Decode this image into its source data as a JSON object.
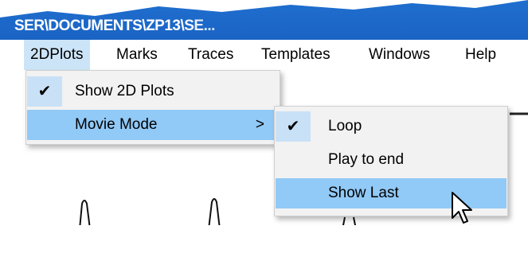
{
  "window": {
    "title": "SER\\DOCUMENTS\\ZP13\\SE..."
  },
  "menubar": {
    "items": [
      {
        "label": "2DPlots"
      },
      {
        "label": "Marks"
      },
      {
        "label": "Traces"
      },
      {
        "label": "Templates"
      },
      {
        "label": "Windows"
      },
      {
        "label": "Help"
      }
    ]
  },
  "dropdown_2dplots": {
    "items": [
      {
        "label": "Show 2D Plots",
        "checked": true,
        "check_glyph": "✔"
      },
      {
        "label": "Movie Mode",
        "submenu_glyph": ">"
      }
    ]
  },
  "submenu_movie_mode": {
    "items": [
      {
        "label": "Loop",
        "checked": true,
        "check_glyph": "✔"
      },
      {
        "label": "Play to end"
      },
      {
        "label": "Show Last"
      }
    ]
  },
  "icons": {
    "checkmark": "checkmark-icon",
    "submenu_arrow": "chevron-right-icon",
    "cursor": "mouse-pointer-icon"
  },
  "colors": {
    "titlebar": "#1a63c4",
    "menu_bg": "#f2f2f2",
    "hover_highlight": "#91c9f7",
    "active_menubar": "#cce4f7"
  }
}
